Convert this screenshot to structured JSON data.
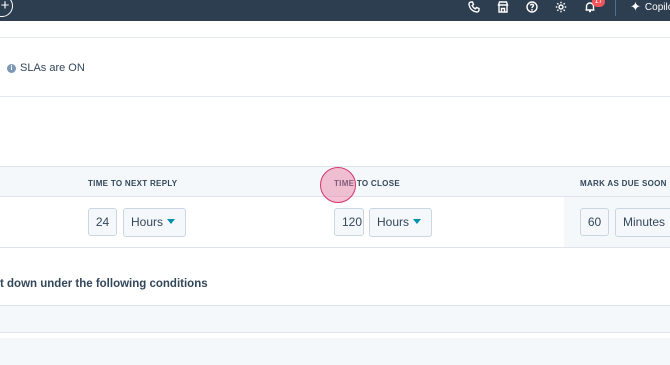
{
  "nav": {
    "plus_symbol": "+",
    "icons": [
      "phone-icon",
      "marketplace-icon",
      "help-icon",
      "settings-icon",
      "bell-icon"
    ],
    "notification_count": "17",
    "copilot_label": "Copilot"
  },
  "sla": {
    "status_text": "SLAs are ON"
  },
  "table": {
    "columns": [
      "TIME TO NEXT REPLY",
      "TIME TO CLOSE",
      "MARK AS DUE SOON"
    ],
    "next_reply": {
      "value": "24",
      "unit": "Hours"
    },
    "close": {
      "value": "120",
      "unit": "Hours"
    },
    "due_soon": {
      "value": "60",
      "unit": "Minutes"
    }
  },
  "conditions_heading": "t down under the following conditions",
  "colors": {
    "nav_bg": "#2d3e50",
    "text": "#33475b",
    "accent_caret": "#0091ae",
    "badge": "#f2545b",
    "click_marker": "#d6336c"
  }
}
